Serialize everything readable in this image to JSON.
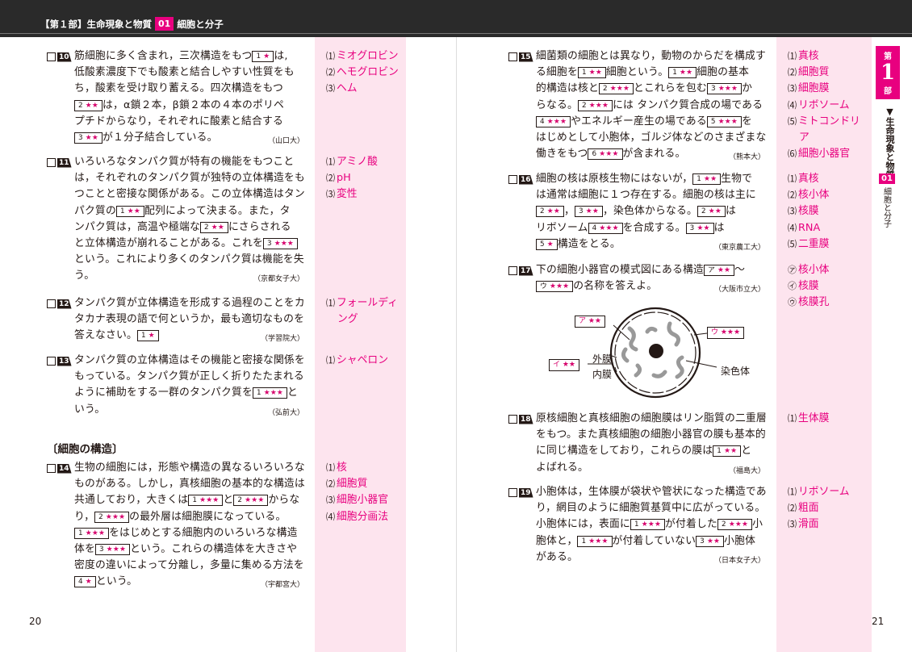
{
  "header": {
    "part": "【第１部】生命現象と物質",
    "chapter_no": "01",
    "chapter": "細胞と分子"
  },
  "section_heading": "〔細胞の構造〕",
  "page_left": "20",
  "page_right": "21",
  "side_tab": {
    "top": "第",
    "big": "1",
    "bottom": "部",
    "title": "▼生命現象と物質",
    "chapter_no": "01",
    "chapter": "細胞と分子"
  },
  "q10": {
    "no": "10",
    "lines": [
      [
        "筋細胞に多く含まれ，三次構造をもつ",
        "1 ★",
        "は,"
      ],
      [
        "低酸素濃度下でも酸素と結合しやすい性質をも"
      ],
      [
        "ち，酸素を受け取り蓄える。四次構造をもつ"
      ],
      [
        "",
        "2 ★★",
        "は，α鎖２本，β鎖２本の４本のポリペ"
      ],
      [
        "プチドからなり，それぞれに酸素と結合する"
      ],
      [
        "",
        "3 ★★",
        "が１分子結合している。"
      ]
    ],
    "source": "（山口大）",
    "answers": [
      "⑴ミオグロビン",
      "⑵ヘモグロビン",
      "⑶ヘム"
    ]
  },
  "q11": {
    "no": "11",
    "lines": [
      [
        "いろいろなタンパク質が特有の機能をもつこと"
      ],
      [
        "は，それぞれのタンパク質が独特の立体構造をも"
      ],
      [
        "つことと密接な関係がある。この立体構造はタン"
      ],
      [
        "パク質の",
        "1 ★★",
        "配列によって決まる。また，タ"
      ],
      [
        "ンパク質は，高温や極端な",
        "2 ★★",
        "にさらされる"
      ],
      [
        "と立体構造が崩れることがある。これを",
        "3 ★★★",
        ""
      ],
      [
        "という。これにより多くのタンパク質は機能を失"
      ],
      [
        "う。"
      ]
    ],
    "source": "（京都女子大）",
    "answers": [
      "⑴アミノ酸",
      "⑵pH",
      "⑶変性"
    ]
  },
  "q12": {
    "no": "12",
    "lines": [
      [
        "タンパク質が立体構造を形成する過程のことをカ"
      ],
      [
        "タカナ表現の語で何というか，最も適切なものを"
      ],
      [
        "答えなさい。",
        "1 ★",
        ""
      ]
    ],
    "source": "（学習院大）",
    "answers": [
      "⑴フォールディ",
      "ング"
    ]
  },
  "q13": {
    "no": "13",
    "lines": [
      [
        "タンパク質の立体構造はその機能と密接な関係を"
      ],
      [
        "もっている。タンパク質が正しく折りたたまれる"
      ],
      [
        "ように補助をする一群のタンパク質を",
        "1 ★★★",
        "と"
      ],
      [
        "いう。"
      ]
    ],
    "source": "（弘前大）",
    "answers": [
      "⑴シャペロン"
    ]
  },
  "q14": {
    "no": "14",
    "lines": [
      [
        "生物の細胞には，形態や構造の異なるいろいろな"
      ],
      [
        "ものがある。しかし，真核細胞の基本的な構造は"
      ],
      [
        "共通しており，大きくは",
        "1 ★★★",
        "と",
        "2 ★★★",
        "からな"
      ],
      [
        "り，",
        "2 ★★★",
        "の最外層は細胞膜になっている。"
      ],
      [
        "",
        "1 ★★★",
        "をはじめとする細胞内のいろいろな構造"
      ],
      [
        "体を",
        "3 ★★★",
        "という。これらの構造体を大きさや"
      ],
      [
        "密度の違いによって分離し，多量に集める方法を"
      ],
      [
        "",
        "4 ★",
        "という。"
      ]
    ],
    "source": "（宇都宮大）",
    "answers": [
      "⑴核",
      "⑵細胞質",
      "⑶細胞小器官",
      "⑷細胞分画法"
    ]
  },
  "q15": {
    "no": "15",
    "lines": [
      [
        "細菌類の細胞とは異なり，動物のからだを構成す"
      ],
      [
        "る細胞を",
        "1 ★★",
        "細胞という。",
        "1 ★★",
        "細胞の基本"
      ],
      [
        "的構造は核と",
        "2 ★★★",
        "とこれらを包む",
        "3 ★★★",
        "か"
      ],
      [
        "らなる。",
        "2 ★★★",
        "には タンパク質合成の場である"
      ],
      [
        "",
        "4 ★★★",
        "やエネルギー産生の場である",
        "5 ★★★",
        "を"
      ],
      [
        "はじめとして小胞体，ゴルジ体などのさまざまな"
      ],
      [
        "働きをもつ",
        "6 ★★★",
        "が含まれる。"
      ]
    ],
    "source": "（熊本大）",
    "answers": [
      "⑴真核",
      "⑵細胞質",
      "⑶細胞膜",
      "⑷リボソーム",
      "⑸ミトコンドリ",
      "ア",
      "⑹細胞小器官"
    ]
  },
  "q16": {
    "no": "16",
    "lines": [
      [
        "細胞の核は原核生物にはないが，",
        "1 ★★",
        "生物で"
      ],
      [
        "は通常は細胞に１つ存在する。細胞の核は主に"
      ],
      [
        "",
        "2 ★★",
        "，",
        "3 ★★",
        "，染色体からなる。",
        "2 ★★",
        "は"
      ],
      [
        "リボソーム",
        "4 ★★★",
        "を合成する。",
        "3 ★★",
        "は"
      ],
      [
        "",
        "5 ★",
        "構造をとる。"
      ]
    ],
    "source": "（東京農工大）",
    "answers": [
      "⑴真核",
      "⑵核小体",
      "⑶核膜",
      "⑷RNA",
      "⑸二重膜"
    ]
  },
  "q17": {
    "no": "17",
    "lines": [
      [
        "下の細胞小器官の模式図にある構造",
        "ア ★★",
        "～"
      ],
      [
        "",
        "ウ ★★★",
        "の名称を答えよ。"
      ]
    ],
    "source": "（大阪市立大）",
    "answers": [
      "㋐核小体",
      "㋑核膜",
      "㋒核膜孔"
    ],
    "diagram": {
      "a": "ア ★★",
      "i": "イ ★★",
      "u": "ウ ★★★",
      "outer": "外膜",
      "inner": "内膜",
      "chrom": "染色体"
    }
  },
  "q18": {
    "no": "18",
    "lines": [
      [
        "原核細胞と真核細胞の細胞膜はリン脂質の二重層"
      ],
      [
        "をもつ。また真核細胞の細胞小器官の膜も基本的"
      ],
      [
        "に同じ構造をしており，これらの膜は",
        "1 ★★",
        "と"
      ],
      [
        "よばれる。"
      ]
    ],
    "source": "（福島大）",
    "answers": [
      "⑴生体膜"
    ]
  },
  "q19": {
    "no": "19",
    "lines": [
      [
        "小胞体は，生体膜が袋状や管状になった構造であ"
      ],
      [
        "り，網目のように細胞質基質中に広がっている。"
      ],
      [
        "小胞体には，表面に",
        "1 ★★★",
        "が付着した",
        "2 ★★★",
        "小"
      ],
      [
        "胞体と，",
        "1 ★★★",
        "が付着していない",
        "3 ★★",
        "小胞体"
      ],
      [
        "がある。"
      ]
    ],
    "source": "（日本女子大）",
    "answers": [
      "⑴リボソーム",
      "⑵粗面",
      "⑶滑面"
    ]
  }
}
